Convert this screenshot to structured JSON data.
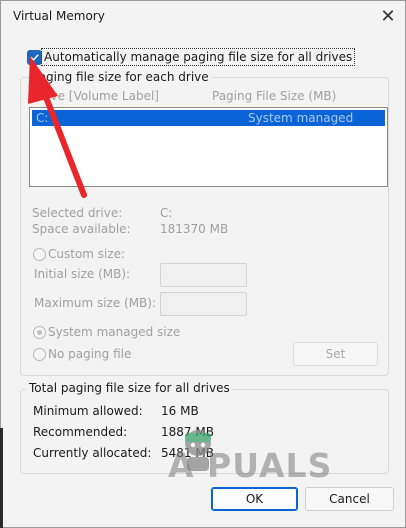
{
  "window": {
    "title": "Virtual Memory",
    "close_glyph": "✕"
  },
  "auto_manage": {
    "label": "Automatically manage paging file size for all drives",
    "checked": true
  },
  "paging_group": {
    "title": "Paging file size for each drive",
    "columns": {
      "drive": "Drive [Volume Label]",
      "size": "Paging File Size (MB)"
    },
    "rows": [
      {
        "drive": "C:",
        "size": "System managed"
      }
    ],
    "selected_drive_label": "Selected drive:",
    "selected_drive_value": "C:",
    "space_label": "Space available:",
    "space_value": "181370 MB",
    "custom_size": "Custom size:",
    "initial_size": "Initial size (MB):",
    "maximum_size": "Maximum size (MB):",
    "system_managed": "System managed size",
    "no_paging": "No paging file",
    "set_button": "Set"
  },
  "total_group": {
    "title": "Total paging file size for all drives",
    "min_label": "Minimum allowed:",
    "min_value": "16 MB",
    "rec_label": "Recommended:",
    "rec_value": "1887 MB",
    "cur_label": "Currently allocated:",
    "cur_value": "5481 MB"
  },
  "buttons": {
    "ok": "OK",
    "cancel": "Cancel"
  },
  "watermark": "A   PUALS",
  "colors": {
    "accent": "#1f66c1",
    "selection": "#0a64d8",
    "arrow": "#e8262b"
  }
}
